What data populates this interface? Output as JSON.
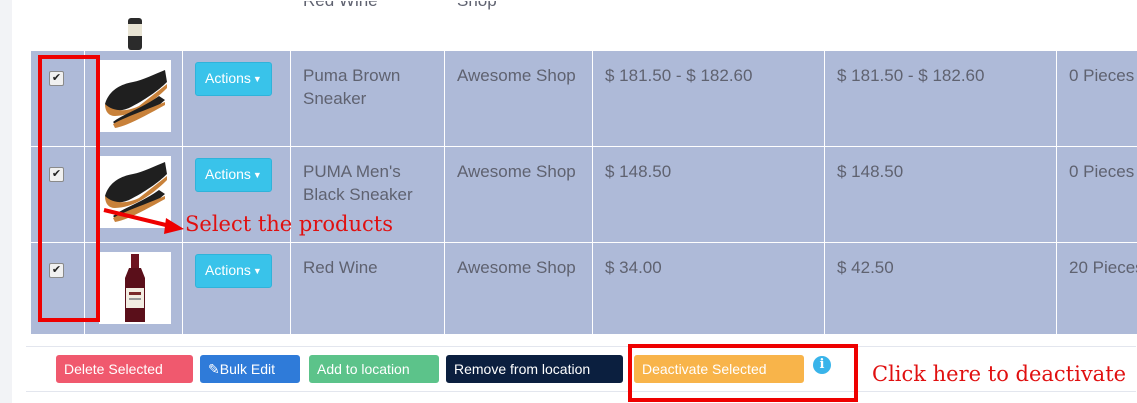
{
  "table": {
    "top_row": {
      "name": "Red Wine",
      "shop": "Shop"
    },
    "rows": [
      {
        "checked": true,
        "image_icon": "sneaker-image",
        "actions_label": "Actions",
        "name": "Puma Brown Sneaker",
        "shop": "Awesome Shop",
        "price": "$ 181.50 - $ 182.60",
        "price_inc_tax": "$ 181.50 - $ 182.60",
        "stock": "0 Pieces"
      },
      {
        "checked": true,
        "image_icon": "sneaker-image",
        "actions_label": "Actions",
        "name": "PUMA Men's Black Sneaker",
        "shop": "Awesome Shop",
        "price": "$ 148.50",
        "price_inc_tax": "$ 148.50",
        "stock": "0 Pieces"
      },
      {
        "checked": true,
        "image_icon": "wine-bottle-image",
        "actions_label": "Actions",
        "name": "Red Wine",
        "shop": "Awesome Shop",
        "price": "$ 34.00",
        "price_inc_tax": "$ 42.50",
        "stock": "20 Pieces"
      }
    ]
  },
  "bulk_actions": {
    "delete_label": "Delete Selected",
    "bulk_edit_label": "Bulk Edit",
    "add_location_label": "Add to location",
    "remove_location_label": "Remove from location",
    "deactivate_label": "Deactivate Selected",
    "info_icon": "i"
  },
  "annotations": {
    "select_text": "Select the products",
    "deactivate_text": "Click here to deactivate"
  },
  "colors": {
    "selected_row": "#aebad8",
    "actions_button": "#39c3ea",
    "delete": "#f0596e",
    "bulk_edit": "#2f7bd9",
    "add_location": "#5cc38a",
    "remove_location": "#0b1f3f",
    "deactivate": "#f8b44a",
    "annotation": "#ee0000"
  }
}
